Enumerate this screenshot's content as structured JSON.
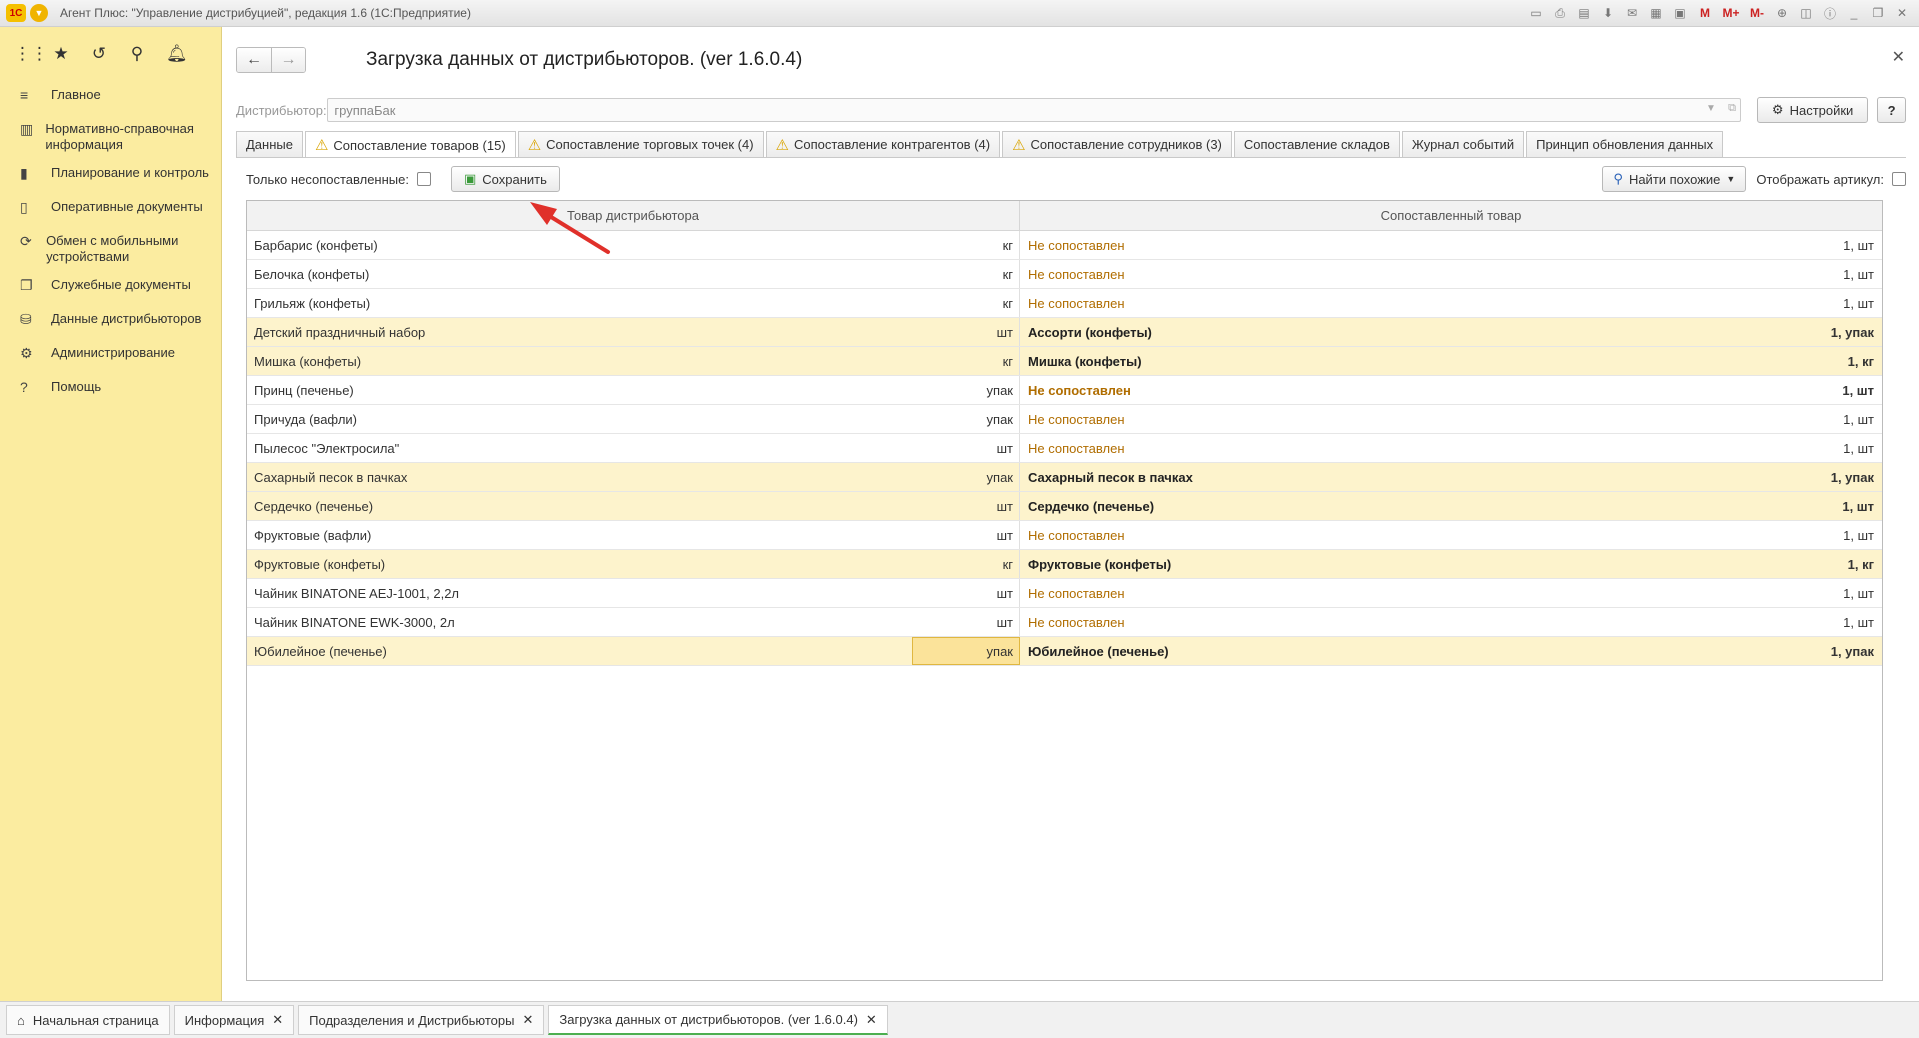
{
  "window": {
    "title": "Агент Плюс: \"Управление дистрибуцией\", редакция 1.6  (1С:Предприятие)",
    "tools": [
      "M",
      "M+",
      "M-"
    ]
  },
  "sidebar": {
    "items": [
      {
        "label": "Главное",
        "icon": "list-icon"
      },
      {
        "label": "Нормативно-справочная информация",
        "icon": "book-icon"
      },
      {
        "label": "Планирование и контроль",
        "icon": "chart-icon"
      },
      {
        "label": "Оперативные документы",
        "icon": "document-icon"
      },
      {
        "label": "Обмен с мобильными устройствами",
        "icon": "sync-icon"
      },
      {
        "label": "Служебные документы",
        "icon": "documents-icon"
      },
      {
        "label": "Данные дистрибьюторов",
        "icon": "data-icon"
      },
      {
        "label": "Администрирование",
        "icon": "gear-icon"
      },
      {
        "label": "Помощь",
        "icon": "question-icon"
      }
    ]
  },
  "form": {
    "title": "Загрузка данных от дистрибьюторов. (ver 1.6.0.4)",
    "distributor_label": "Дистрибьютор:",
    "distributor_value": "группаБак",
    "settings_label": "Настройки",
    "help_label": "?"
  },
  "tabs": [
    {
      "label": "Данные",
      "warn": false
    },
    {
      "label": "Сопоставление товаров (15)",
      "warn": true,
      "active": true
    },
    {
      "label": "Сопоставление торговых точек (4)",
      "warn": true
    },
    {
      "label": "Сопоставление контрагентов (4)",
      "warn": true
    },
    {
      "label": "Сопоставление сотрудников (3)",
      "warn": true
    },
    {
      "label": "Сопоставление складов",
      "warn": false
    },
    {
      "label": "Журнал событий",
      "warn": false
    },
    {
      "label": "Принцип обновления данных",
      "warn": false
    }
  ],
  "toolbar": {
    "only_unmatched_label": "Только несопоставленные:",
    "save_label": "Сохранить",
    "find_similar_label": "Найти похожие",
    "show_article_label": "Отображать артикул:"
  },
  "grid": {
    "col_distributor": "Товар дистрибьютора",
    "col_matched": "Сопоставленный товар",
    "rows": [
      {
        "name": "Барбарис (конфеты)",
        "unit": "кг",
        "matched": "Не сопоставлен",
        "qty": "1, шт",
        "style": "plain"
      },
      {
        "name": "Белочка (конфеты)",
        "unit": "кг",
        "matched": "Не сопоставлен",
        "qty": "1, шт",
        "style": "plain"
      },
      {
        "name": "Грильяж (конфеты)",
        "unit": "кг",
        "matched": "Не сопоставлен",
        "qty": "1, шт",
        "style": "plain"
      },
      {
        "name": "Детский праздничный набор",
        "unit": "шт",
        "matched": "Ассорти (конфеты)",
        "qty": "1, упак",
        "style": "bold sel"
      },
      {
        "name": "Мишка (конфеты)",
        "unit": "кг",
        "matched": "Мишка (конфеты)",
        "qty": "1, кг",
        "style": "bold sel"
      },
      {
        "name": "Принц (печенье)",
        "unit": "упак",
        "matched": "Не сопоставлен",
        "qty": "1, шт",
        "style": "boldorange"
      },
      {
        "name": "Причуда (вафли)",
        "unit": "упак",
        "matched": "Не сопоставлен",
        "qty": "1, шт",
        "style": "plain"
      },
      {
        "name": "Пылесос \"Электросила\"",
        "unit": "шт",
        "matched": "Не сопоставлен",
        "qty": "1, шт",
        "style": "plain"
      },
      {
        "name": "Сахарный песок в пачках",
        "unit": "упак",
        "matched": "Сахарный песок в пачках",
        "qty": "1, упак",
        "style": "bold sel"
      },
      {
        "name": "Сердечко (печенье)",
        "unit": "шт",
        "matched": "Сердечко (печенье)",
        "qty": "1, шт",
        "style": "bold sel"
      },
      {
        "name": "Фруктовые (вафли)",
        "unit": "шт",
        "matched": "Не сопоставлен",
        "qty": "1, шт",
        "style": "plain"
      },
      {
        "name": "Фруктовые (конфеты)",
        "unit": "кг",
        "matched": "Фруктовые (конфеты)",
        "qty": "1, кг",
        "style": "bold sel"
      },
      {
        "name": "Чайник BINATONE  AEJ-1001,  2,2л",
        "unit": "шт",
        "matched": "Не сопоставлен",
        "qty": "1, шт",
        "style": "plain"
      },
      {
        "name": "Чайник BINATONE  EWK-3000,  2л",
        "unit": "шт",
        "matched": "Не сопоставлен",
        "qty": "1, шт",
        "style": "plain"
      },
      {
        "name": "Юбилейное (печенье)",
        "unit": "упак",
        "matched": "Юбилейное (печенье)",
        "qty": "1, упак",
        "style": "bold sel focus"
      }
    ]
  },
  "taskbar": {
    "items": [
      {
        "label": "Начальная страница",
        "home": true,
        "closable": false
      },
      {
        "label": "Информация",
        "closable": true
      },
      {
        "label": "Подразделения и Дистрибьюторы",
        "closable": true
      },
      {
        "label": "Загрузка данных от дистрибьюторов. (ver 1.6.0.4)",
        "closable": true,
        "active": true
      }
    ]
  },
  "colors": {
    "sidebar": "#fbeca0",
    "unmatched_text": "#b06d00",
    "selected_row": "#fdf3cc",
    "annotation_arrow": "#e0302a"
  }
}
